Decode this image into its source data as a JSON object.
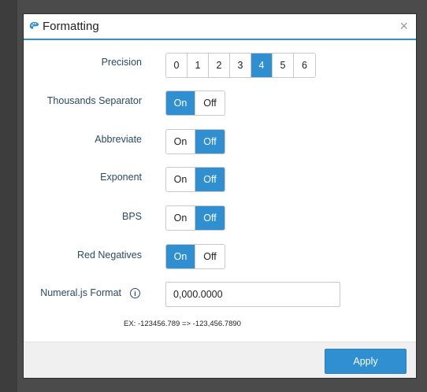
{
  "dialog": {
    "title": "Formatting",
    "close_glyph": "×"
  },
  "icons": {
    "title_icon": "palette-icon",
    "close_icon": "close-icon",
    "info_icon": "info-icon"
  },
  "colors": {
    "accent": "#2f8fd1",
    "label": "#2a4a66"
  },
  "precision": {
    "label": "Precision",
    "options": [
      "0",
      "1",
      "2",
      "3",
      "4",
      "5",
      "6"
    ],
    "selected": "4"
  },
  "toggles": [
    {
      "key": "thousands",
      "label": "Thousands Separator",
      "on_label": "On",
      "off_label": "Off",
      "value": "On"
    },
    {
      "key": "abbreviate",
      "label": "Abbreviate",
      "on_label": "On",
      "off_label": "Off",
      "value": "Off"
    },
    {
      "key": "exponent",
      "label": "Exponent",
      "on_label": "On",
      "off_label": "Off",
      "value": "Off"
    },
    {
      "key": "bps",
      "label": "BPS",
      "on_label": "On",
      "off_label": "Off",
      "value": "Off"
    },
    {
      "key": "red_negatives",
      "label": "Red Negatives",
      "on_label": "On",
      "off_label": "Off",
      "value": "On"
    }
  ],
  "numeral_format": {
    "label": "Numeral.js Format",
    "info_glyph": "i",
    "value": "0,000.0000"
  },
  "example": "EX: -123456.789 => -123,456.7890",
  "footer": {
    "apply_label": "Apply"
  }
}
